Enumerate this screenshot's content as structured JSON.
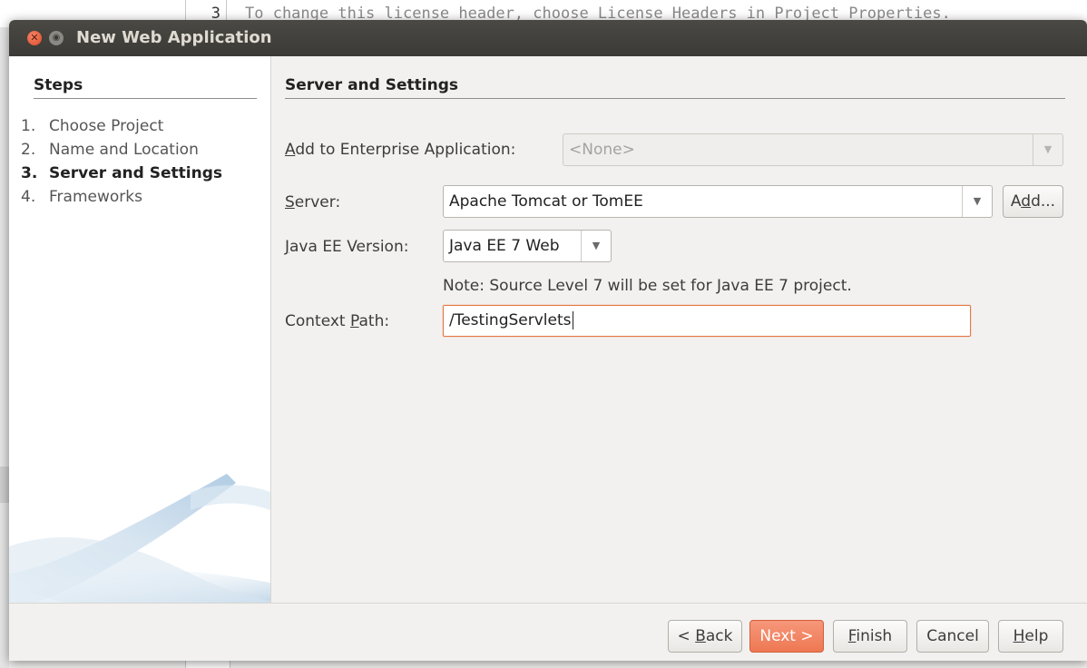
{
  "background_editor": {
    "line_number": "3",
    "code_text": "To change this license header, choose License Headers in Project Properties."
  },
  "dialog": {
    "title": "New Web Application"
  },
  "steps": {
    "heading": "Steps",
    "items": [
      {
        "num": "1.",
        "label": "Choose Project",
        "active": false
      },
      {
        "num": "2.",
        "label": "Name and Location",
        "active": false
      },
      {
        "num": "3.",
        "label": "Server and Settings",
        "active": true
      },
      {
        "num": "4.",
        "label": "Frameworks",
        "active": false
      }
    ]
  },
  "panel": {
    "title": "Server and Settings",
    "enterprise_app": {
      "label_mnemonic": "A",
      "label_rest": "dd to Enterprise Application:",
      "value": "<None>",
      "disabled": true
    },
    "server": {
      "label_mnemonic": "S",
      "label_rest": "erver:",
      "value": "Apache Tomcat or TomEE",
      "add_button_pre": "A",
      "add_button_mnemonic": "d",
      "add_button_post": "d..."
    },
    "javaee": {
      "label_mnemonic": "J",
      "label_rest": "ava EE Version:",
      "value": "Java EE 7 Web"
    },
    "note": "Note: Source Level 7 will be set for Java EE 7 project.",
    "context_path": {
      "label_pre": "Context ",
      "label_mnemonic": "P",
      "label_rest": "ath:",
      "value": "/TestingServlets"
    }
  },
  "footer": {
    "back": {
      "pre": "< ",
      "mnemonic": "B",
      "post": "ack"
    },
    "next": {
      "label": "Next >"
    },
    "finish": {
      "mnemonic": "F",
      "post": "inish"
    },
    "cancel": {
      "label": "Cancel"
    },
    "help": {
      "mnemonic": "H",
      "post": "elp"
    }
  },
  "icons": {
    "close": "close-icon",
    "minimize": "minimize-icon",
    "dropdown": "chevron-down-icon"
  },
  "colors": {
    "accent": "#ee7852",
    "titlebar": "#3b3a36",
    "focus_border": "#e57745"
  }
}
